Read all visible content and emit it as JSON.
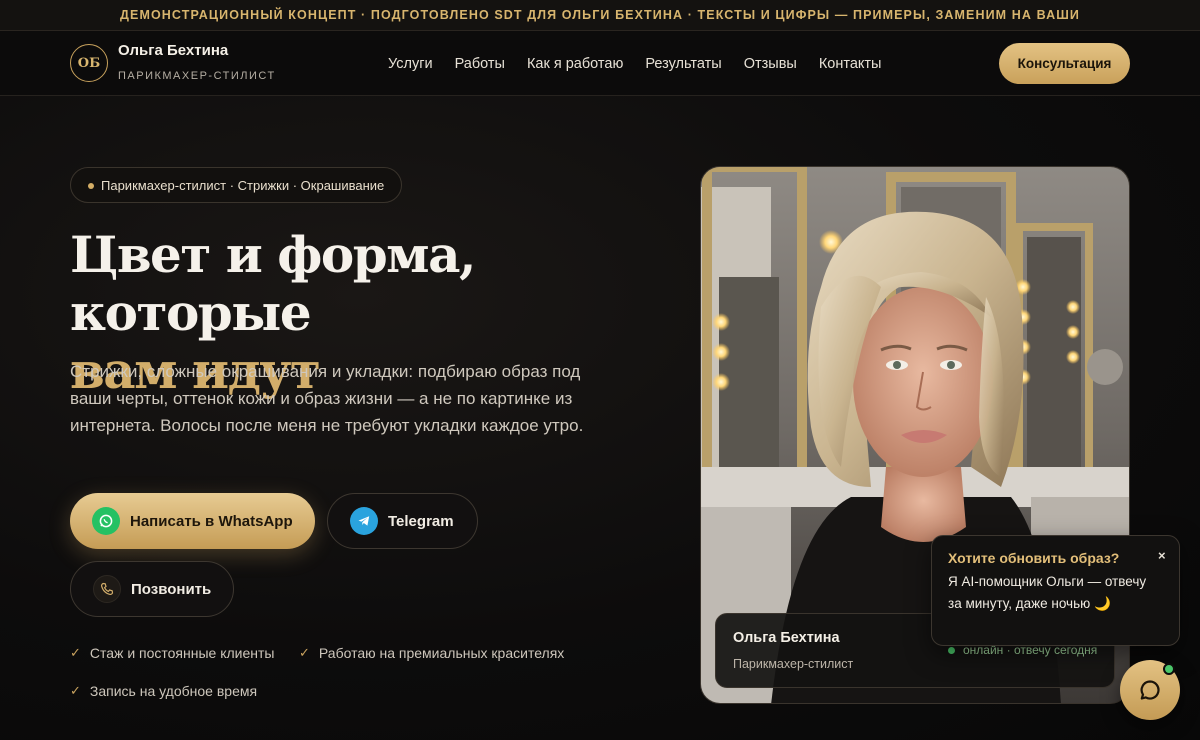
{
  "topbar": {
    "notice": "ДЕМОНСТРАЦИОННЫЙ КОНЦЕПТ · ПОДГОТОВЛЕНО SDT ДЛЯ ОЛЬГИ БЕХТИНА · ТЕКСТЫ И ЦИФРЫ — ПРИМЕРЫ, ЗАМЕНИМ НА ВАШИ"
  },
  "header": {
    "logo_initials": "ОБ",
    "brand_name": "Ольга Бехтина",
    "brand_sub": "ПАРИКМАХЕР-СТИЛИСТ",
    "nav": [
      "Услуги",
      "Работы",
      "Как я работаю",
      "Результаты",
      "Отзывы",
      "Контакты"
    ],
    "cta_label": "Консультация"
  },
  "hero": {
    "pill_text": "Парикмахер-стилист · Стрижки · Окрашивание",
    "title_line1": "Цвет и форма, которые",
    "title_line2": "вам идут",
    "description": "Стрижки, сложные окрашивания и укладки: подбираю образ под ваши черты, оттенок кожи и образ жизни — а не по картинке из интернета. Волосы после меня не требуют укладки каждое утро.",
    "buttons": {
      "whatsapp": "Написать в WhatsApp",
      "telegram": "Telegram",
      "call": "Позвонить"
    },
    "checks": [
      "Стаж и постоянные клиенты",
      "Работаю на премиальных красителях",
      "Запись на удобное время"
    ]
  },
  "profile_card": {
    "name": "Ольга Бехтина",
    "role": "Парикмахер-стилист",
    "status": "онлайн · отвечу сегодня"
  },
  "chat_popup": {
    "title": "Хотите обновить образ?",
    "body": "Я AI-помощник Ольги — отвечу за минуту, даже ночью 🌙",
    "close": "×"
  },
  "colors": {
    "accent_gold": "#d2ad6a",
    "background": "#0d0c0c",
    "whatsapp": "#25c163",
    "telegram": "#2aa3de",
    "online": "#4bc76a"
  }
}
